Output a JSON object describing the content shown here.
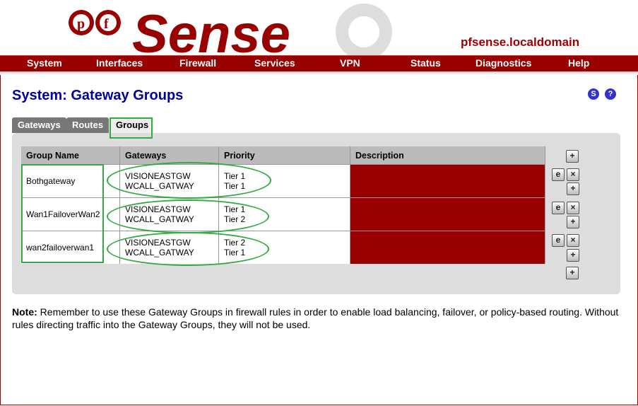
{
  "header": {
    "hostname": "pfsense.localdomain",
    "logo_text": "Sense",
    "logo_letters": [
      "p",
      "f"
    ]
  },
  "nav": [
    "System",
    "Interfaces",
    "Firewall",
    "Services",
    "VPN",
    "Status",
    "Diagnostics",
    "Help"
  ],
  "page": {
    "title": "System: Gateway Groups",
    "status_icon": "S",
    "help_icon": "?"
  },
  "tabs": [
    {
      "label": "Gateways",
      "active": false
    },
    {
      "label": "Routes",
      "active": false
    },
    {
      "label": "Groups",
      "active": true
    }
  ],
  "table": {
    "headers": [
      "Group Name",
      "Gateways",
      "Priority",
      "Description"
    ],
    "rows": [
      {
        "name": "Bothgateway",
        "gateways": [
          "VISIONEASTGW",
          "WCALL_GATWAY"
        ],
        "priority": [
          "Tier 1",
          "Tier 1"
        ],
        "description": ""
      },
      {
        "name": "Wan1FailoverWan2",
        "gateways": [
          "VISIONEASTGW",
          "WCALL_GATWAY"
        ],
        "priority": [
          "Tier 1",
          "Tier 2"
        ],
        "description": ""
      },
      {
        "name": "wan2failoverwan1",
        "gateways": [
          "VISIONEASTGW",
          "WCALL_GATWAY"
        ],
        "priority": [
          "Tier 2",
          "Tier 1"
        ],
        "description": ""
      }
    ]
  },
  "icons": {
    "edit": "e",
    "delete": "×",
    "add": "+"
  },
  "note": {
    "label": "Note:",
    "text": " Remember to use these Gateway Groups in firewall rules in order to enable load balancing, failover, or policy-based routing. Without rules directing traffic into the Gateway Groups, they will not be used."
  },
  "colors": {
    "brand": "#990000",
    "title": "#000099",
    "annotation": "#33aa44"
  }
}
